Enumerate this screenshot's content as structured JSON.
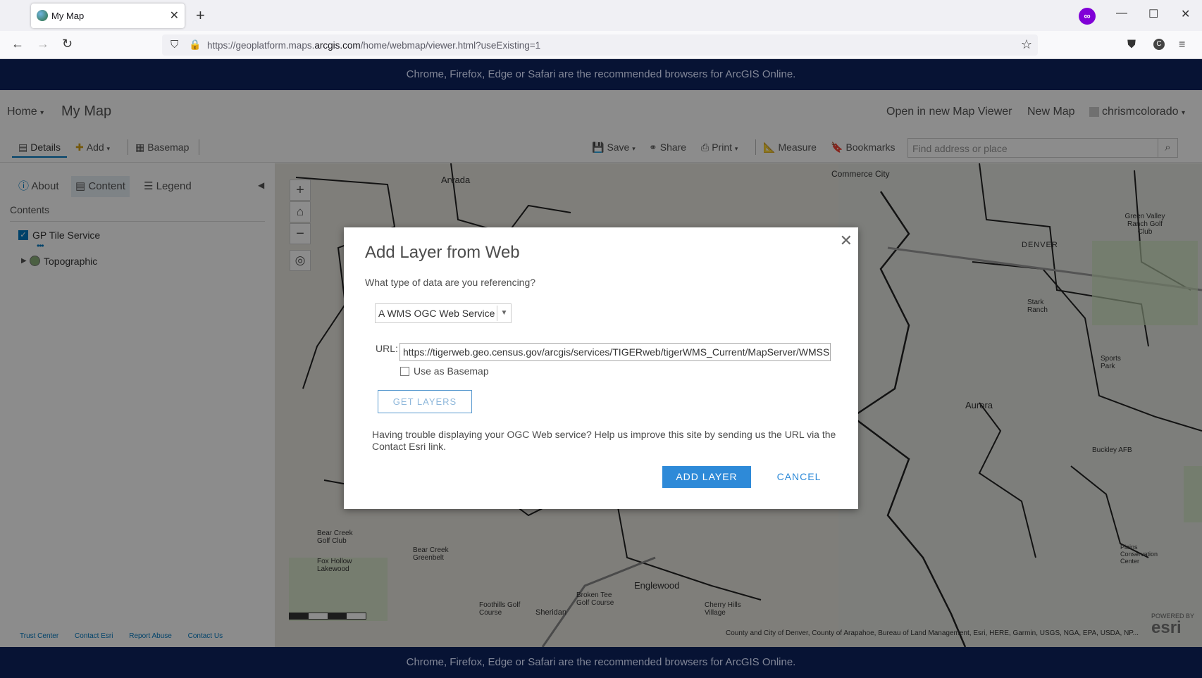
{
  "browser": {
    "tab_title": "My Map",
    "url_prefix": "https://geoplatform.maps.",
    "url_domain": "arcgis.com",
    "url_suffix": "/home/webmap/viewer.html?useExisting=1"
  },
  "banner": {
    "top_text": "Chrome, Firefox, Edge or Safari are the recommended browsers for ArcGIS Online.",
    "bottom_text": "Chrome, Firefox, Edge or Safari are the recommended browsers for ArcGIS Online."
  },
  "header": {
    "home_label": "Home",
    "map_title": "My Map",
    "open_new_viewer": "Open in new Map Viewer",
    "new_map": "New Map",
    "username": "chrismcolorado"
  },
  "toolbar": {
    "details": "Details",
    "add": "Add",
    "basemap": "Basemap",
    "save": "Save",
    "share": "Share",
    "print": "Print",
    "measure": "Measure",
    "bookmarks": "Bookmarks",
    "search_placeholder": "Find address or place"
  },
  "sidebar": {
    "tabs": {
      "about": "About",
      "content": "Content",
      "legend": "Legend"
    },
    "contents_label": "Contents",
    "layers": [
      {
        "name": "GP Tile Service",
        "checked": true
      },
      {
        "name": "Topographic"
      }
    ],
    "footer": [
      "Trust Center",
      "Contact Esri",
      "Report Abuse",
      "Contact Us"
    ]
  },
  "map": {
    "labels": [
      "Arvada",
      "Commerce City",
      "DENVER",
      "Aurora",
      "Englewood",
      "Sheridan",
      "Green Valley Ranch Golf Club",
      "Bear Creek Golf Club",
      "Fox Hollow Lakewood",
      "Cherry Hills Village",
      "Buckley AFB",
      "Plains Conservation Center",
      "Bear Creek Greenbelt",
      "Broken Tee Golf Course",
      "Foothills Golf Course",
      "Stark Ranch",
      "Sports Park"
    ],
    "attribution": "County and City of Denver, County of Arapahoe, Bureau of Land Management, Esri, HERE, Garmin, USGS, NGA, EPA, USDA, NP...",
    "esri_logo": "esri",
    "powered_by": "POWERED BY"
  },
  "dialog": {
    "title": "Add Layer from Web",
    "question": "What type of data are you referencing?",
    "selected_type": "A WMS OGC Web Service",
    "url_label": "URL:",
    "url_value": "https://tigerweb.geo.census.gov/arcgis/services/TIGERweb/tigerWMS_Current/MapServer/WMSServer",
    "basemap_label": "Use as Basemap",
    "basemap_checked": false,
    "get_layers": "GET LAYERS",
    "help_text": "Having trouble displaying your OGC Web service? Help us improve this site by sending us the URL via the Contact Esri link.",
    "add_layer": "ADD LAYER",
    "cancel": "CANCEL"
  },
  "colors": {
    "banner_bg": "#0b1c4b",
    "accent": "#2e8ad8",
    "privacy_purple": "#8000d7"
  }
}
